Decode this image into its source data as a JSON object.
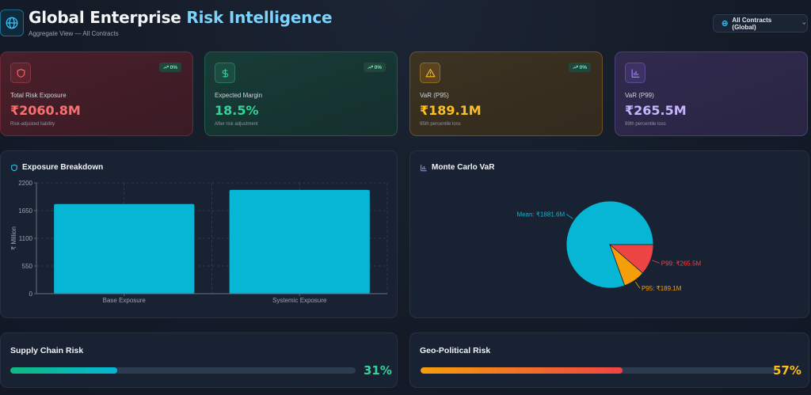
{
  "header": {
    "title_part1": "Global Enterprise",
    "title_part2": "Risk Intelligence",
    "subtitle": "Aggregate View — All Contracts",
    "scope_label": "All Contracts (Global)"
  },
  "kpis": [
    {
      "label": "Total Risk Exposure",
      "value": "₹2060.8M",
      "sub": "Risk-adjusted liability",
      "trend": "0%",
      "icon": "shield-icon"
    },
    {
      "label": "Expected Margin",
      "value": "18.5%",
      "sub": "After risk adjustment",
      "trend": "0%",
      "icon": "dollar-icon"
    },
    {
      "label": "VaR (P95)",
      "value": "₹189.1M",
      "sub": "95th percentile loss",
      "trend": "0%",
      "icon": "warning-icon"
    },
    {
      "label": "VaR (P99)",
      "value": "₹265.5M",
      "sub": "99th percentile loss",
      "icon": "bar-chart-icon"
    }
  ],
  "exposure": {
    "title": "Exposure Breakdown"
  },
  "montecarlo": {
    "title": "Monte Carlo VaR"
  },
  "supply_chain": {
    "title": "Supply Chain Risk",
    "percent": 31,
    "percent_label": "31%"
  },
  "geo_political": {
    "title": "Geo-Political Risk",
    "percent": 57,
    "percent_label": "57%"
  },
  "colors": {
    "cyan": "#06b6d4",
    "red": "#ef4444",
    "amber": "#f59e0b"
  },
  "chart_data": [
    {
      "type": "bar",
      "categories": [
        "Base Exposure",
        "Systemic Exposure"
      ],
      "values": [
        1780,
        2060.8
      ],
      "ylabel": "₹ Million",
      "ylim": [
        0,
        2200
      ],
      "yticks": [
        0,
        550,
        1100,
        1650,
        2200
      ],
      "grid": true
    },
    {
      "type": "pie",
      "slices": [
        {
          "label": "Mean: ₹1881.6M",
          "value": 1881.6,
          "color": "#06b6d4"
        },
        {
          "label": "P99: ₹265.5M",
          "value": 265.5,
          "color": "#ef4444"
        },
        {
          "label": "P95: ₹189.1M",
          "value": 189.1,
          "color": "#f59e0b"
        }
      ]
    }
  ]
}
